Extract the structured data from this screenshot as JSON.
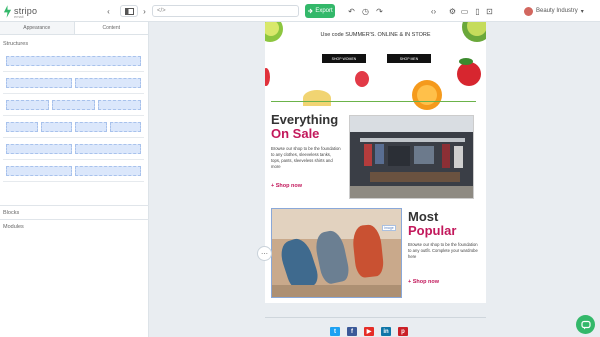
{
  "app": {
    "logo_text": "stripo",
    "logo_sub": "email"
  },
  "toolbar": {
    "url_text": "</>",
    "export_label": "Export",
    "account_label": "Beauty Industry"
  },
  "panel": {
    "tabs": [
      {
        "label": "Appearance",
        "active": false
      },
      {
        "label": "Content",
        "active": true
      }
    ],
    "structures_title": "Structures",
    "structure_cells": [
      1,
      2,
      3,
      4,
      2,
      2
    ],
    "blocks_label": "Blocks",
    "modules_label": "Modules"
  },
  "email": {
    "promo_text": "Use code SUMMER'S. ONLINE & IN STORE",
    "btn_women": "SHOP WOMEN",
    "btn_men": "SHOP MEN",
    "sale": {
      "title_1": "Everything",
      "title_2": "On Sale",
      "body": "Browse our shop to be the foundation to any clothes, sleeveless tanks, tops, pants, sleeveless shirts and more",
      "link": "+ Shop now"
    },
    "popular": {
      "title_1": "Most",
      "title_2": "Popular",
      "body": "Browse our shop to be the foundation to any outfit. Complete your wardrobe here",
      "link": "+ Shop now"
    },
    "selection_label": "Image"
  },
  "colors": {
    "accent_green": "#33b86a",
    "pink": "#c2185b",
    "divider_green": "#6bb34a"
  }
}
